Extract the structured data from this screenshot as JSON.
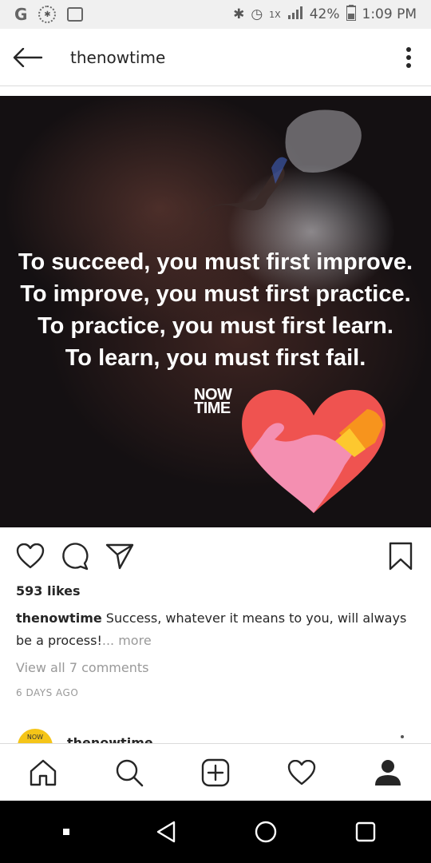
{
  "status_bar": {
    "data_speed": "1X",
    "battery": "42%",
    "time": "1:09 PM"
  },
  "header": {
    "title": "thenowtime"
  },
  "post": {
    "quote_lines": [
      "To succeed, you must first improve.",
      "To improve, you must first practice.",
      "To practice, you must first learn.",
      "To learn, you must first fail."
    ],
    "logo_text": [
      "NOW",
      "TIME"
    ],
    "likes": "593 likes",
    "caption_user": "thenowtime",
    "caption_text": " Success, whatever it means to you, will always be a process!",
    "caption_more": "... more",
    "view_comments": "View all 7 comments",
    "timestamp": "6 DAYS AGO"
  },
  "next_post": {
    "avatar_text": "NOW",
    "username": "thenowtime"
  },
  "colors": {
    "heart_red": "#ef5350",
    "heart_pink": "#f48fb1",
    "heart_orange": "#f7941d",
    "heart_yellow": "#fdc82f"
  },
  "icons": {
    "header": [
      "back-arrow-icon",
      "more-vertical-icon"
    ],
    "actions": [
      "heart-icon",
      "comment-icon",
      "share-icon",
      "bookmark-icon"
    ],
    "nav": [
      "home-icon",
      "search-icon",
      "add-post-icon",
      "activity-heart-icon",
      "profile-icon"
    ],
    "android": [
      "recents-dot-icon",
      "back-triangle-icon",
      "home-circle-icon",
      "overview-square-icon"
    ]
  }
}
